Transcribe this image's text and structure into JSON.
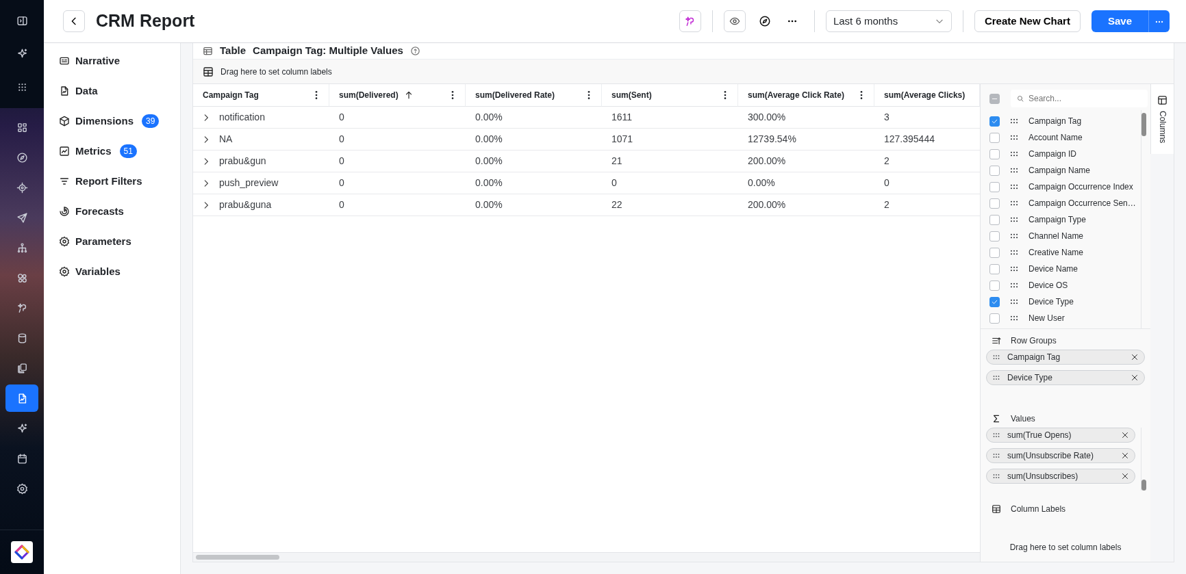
{
  "rail_items": [
    {
      "selected": false
    },
    {
      "selected": false
    },
    {
      "selected": false
    },
    {
      "selected": false
    },
    {
      "selected": false
    },
    {
      "selected": false
    },
    {
      "selected": false
    },
    {
      "selected": false
    },
    {
      "selected": false
    },
    {
      "selected": false
    },
    {
      "selected": false
    },
    {
      "selected": false
    },
    {
      "selected": true
    },
    {
      "selected": false
    },
    {
      "selected": false
    },
    {
      "selected": false
    }
  ],
  "header": {
    "title": "CRM Report",
    "date_range": "Last 6 months",
    "create_button": "Create New Chart",
    "save_button": "Save"
  },
  "nav": [
    {
      "label": "Narrative"
    },
    {
      "label": "Data"
    },
    {
      "label": "Dimensions",
      "count": "39"
    },
    {
      "label": "Metrics",
      "count": "51"
    },
    {
      "label": "Report Filters"
    },
    {
      "label": "Forecasts"
    },
    {
      "label": "Parameters"
    },
    {
      "label": "Variables"
    }
  ],
  "card": {
    "title": "Table",
    "subtitle": "Campaign Tag: Multiple Values",
    "drop_hint": "Drag here to set column labels"
  },
  "table": {
    "columns": [
      {
        "label": "Campaign Tag",
        "sorted": false,
        "menu": true
      },
      {
        "label": "sum(Delivered)",
        "sorted": true,
        "menu": true
      },
      {
        "label": "sum(Delivered Rate)",
        "sorted": false,
        "menu": true
      },
      {
        "label": "sum(Sent)",
        "sorted": false,
        "menu": true
      },
      {
        "label": "sum(Average Click Rate)",
        "sorted": false,
        "menu": true
      },
      {
        "label": "sum(Average Clicks)",
        "sorted": false,
        "menu": false
      }
    ],
    "rows": [
      {
        "expanded": false,
        "cells": [
          "notification",
          "0",
          "0.00%",
          "1611",
          "300.00%",
          "3"
        ]
      },
      {
        "expanded": false,
        "cells": [
          "NA",
          "0",
          "0.00%",
          "1071",
          "12739.54%",
          "127.395444"
        ]
      },
      {
        "expanded": false,
        "cells": [
          "prabu&gun",
          "0",
          "0.00%",
          "21",
          "200.00%",
          "2"
        ]
      },
      {
        "expanded": false,
        "cells": [
          "push_preview",
          "0",
          "0.00%",
          "0",
          "0.00%",
          "0"
        ]
      },
      {
        "expanded": false,
        "cells": [
          "prabu&guna",
          "0",
          "0.00%",
          "22",
          "200.00%",
          "2"
        ]
      }
    ]
  },
  "column_panel": {
    "select_all_indeterminate": true,
    "search_placeholder": "Search...",
    "side_tab": "Columns",
    "columns": [
      {
        "label": "Campaign Tag",
        "checked": true
      },
      {
        "label": "Account Name",
        "checked": false
      },
      {
        "label": "Campaign ID",
        "checked": false
      },
      {
        "label": "Campaign Name",
        "checked": false
      },
      {
        "label": "Campaign Occurrence Index",
        "checked": false
      },
      {
        "label": "Campaign Occurrence Sen…",
        "checked": false
      },
      {
        "label": "Campaign Type",
        "checked": false
      },
      {
        "label": "Channel Name",
        "checked": false
      },
      {
        "label": "Creative Name",
        "checked": false
      },
      {
        "label": "Device Name",
        "checked": false
      },
      {
        "label": "Device OS",
        "checked": false
      },
      {
        "label": "Device Type",
        "checked": true
      },
      {
        "label": "New User",
        "checked": false
      }
    ],
    "row_groups_title": "Row Groups",
    "row_groups": [
      "Campaign Tag",
      "Device Type"
    ],
    "values_title": "Values",
    "values": [
      "sum(True Opens)",
      "sum(Unsubscribe Rate)",
      "sum(Unsubscribes)"
    ],
    "column_labels_title": "Column Labels",
    "column_labels_hint": "Drag here to set column labels"
  }
}
